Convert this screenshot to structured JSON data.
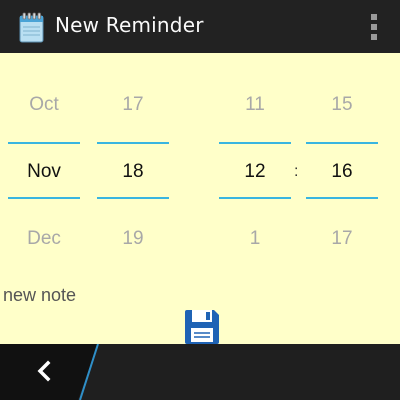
{
  "app": {
    "title": "New Reminder",
    "icon": "notepad-calendar-icon",
    "menu_icon": "overflow-menu-icon"
  },
  "picker": {
    "month": {
      "prev": "Oct",
      "selected": "Nov",
      "next": "Dec"
    },
    "day": {
      "prev": "17",
      "selected": "18",
      "next": "19"
    },
    "hour": {
      "prev": "11",
      "selected": "12",
      "next": "1"
    },
    "minute": {
      "prev": "15",
      "selected": "16",
      "next": "17"
    },
    "separator": ":"
  },
  "note": {
    "text": "new note"
  },
  "actions": {
    "save_icon": "floppy-disk-icon",
    "back_icon": "back-chevron-icon"
  },
  "colors": {
    "action_bar": "#222222",
    "background": "#ffffc9",
    "divider": "#39b5e0",
    "save": "#1f63b5"
  }
}
